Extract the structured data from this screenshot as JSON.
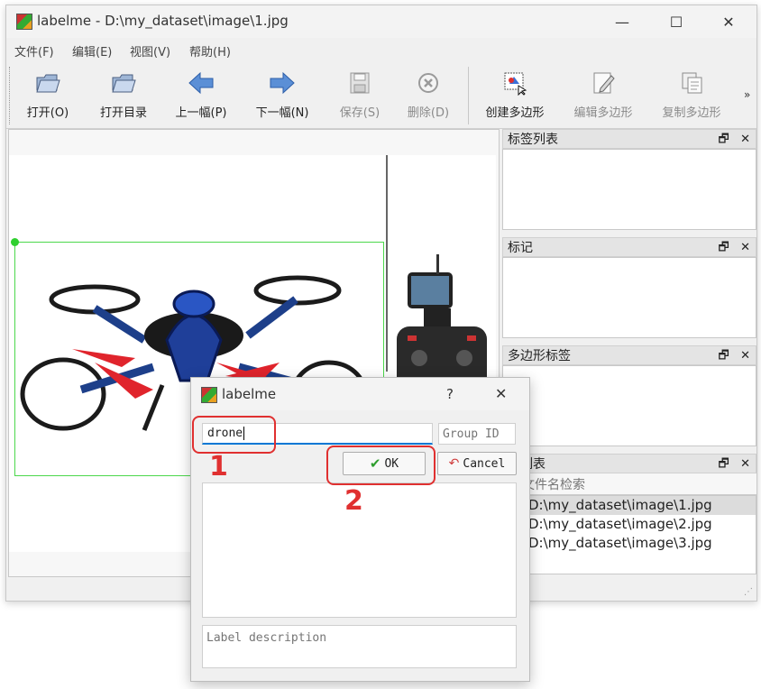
{
  "window": {
    "title": "labelme - D:\\my_dataset\\image\\1.jpg",
    "controls": {
      "minimize": "—",
      "maximize": "☐",
      "close": "✕"
    }
  },
  "menu": [
    "文件(F)",
    "编辑(E)",
    "视图(V)",
    "帮助(H)"
  ],
  "toolbar": {
    "open": "打开(O)",
    "open_dir": "打开目录",
    "prev": "上一幅(P)",
    "next": "下一幅(N)",
    "save": "保存(S)",
    "delete": "删除(D)",
    "create_polygon": "创建多边形",
    "edit_polygon": "编辑多边形",
    "copy_polygon": "复制多边形",
    "more": "»"
  },
  "docks": {
    "label_list": {
      "title": "标签列表"
    },
    "flags": {
      "title": "标记"
    },
    "polygon_labels": {
      "title": "多边形标签"
    },
    "file_list": {
      "title": "件列表",
      "search_placeholder": "文件名检索",
      "files": [
        "D:\\my_dataset\\image\\1.jpg",
        "D:\\my_dataset\\image\\2.jpg",
        "D:\\my_dataset\\image\\3.jpg"
      ]
    },
    "btn_float": "🗗",
    "btn_close": "✕"
  },
  "dialog": {
    "title": "labelme",
    "help": "?",
    "close": "✕",
    "label_value": "drone",
    "group_id_placeholder": "Group ID",
    "ok": "OK",
    "cancel": "Cancel",
    "description_placeholder": "Label description"
  },
  "annotations": {
    "step1": "1",
    "step2": "2"
  },
  "colors": {
    "bbox": "#4cd84c",
    "annotation": "#e03030",
    "selected_row": "#dcdcdc"
  }
}
